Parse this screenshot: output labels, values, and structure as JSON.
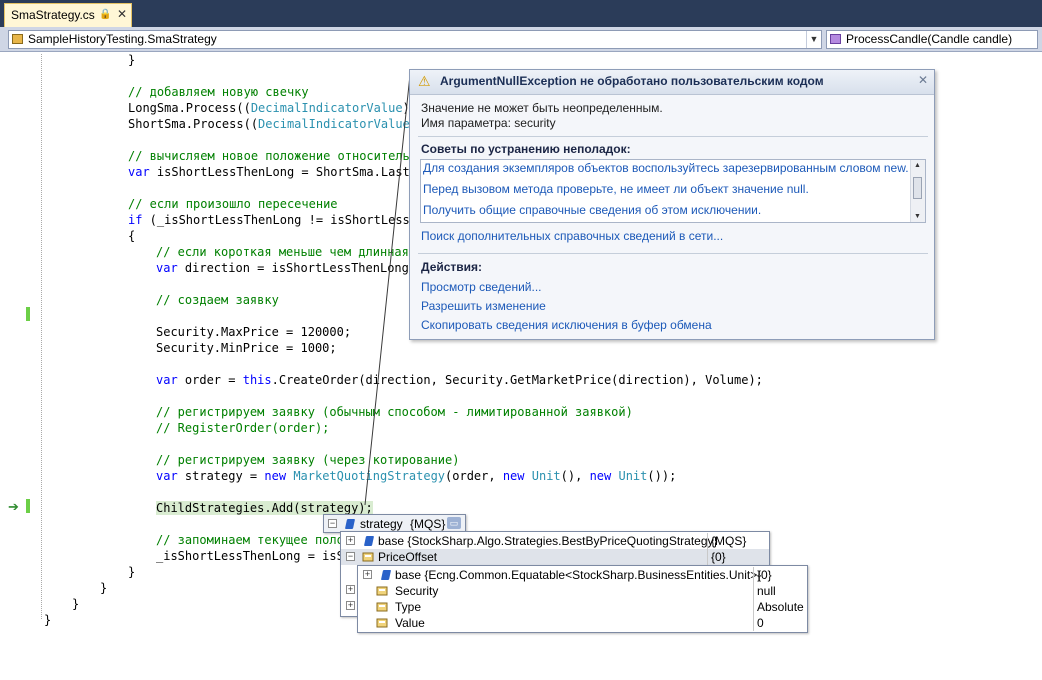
{
  "tab": {
    "title": "SmaStrategy.cs",
    "lock_icon": "lock-icon",
    "close_icon": "close-icon"
  },
  "navbar": {
    "type_combo": "SampleHistoryTesting.SmaStrategy",
    "member_combo": "ProcessCandle(Candle candle)"
  },
  "code": {
    "l1": "}",
    "l3": "// добавляем новую свечку",
    "l4a": "LongSma.Process((",
    "l4b": "DecimalIndicatorValue",
    "l4c": ")c",
    "l5a": "ShortSma.Process((",
    "l5b": "DecimalIndicatorValue",
    "l5c": ")",
    "l7": "// вычисляем новое положение относительн",
    "l8a": "var",
    "l8b": " isShortLessThenLong = ShortSma.LastV",
    "l10": "// если произошло пересечение",
    "l11a": "if",
    "l11b": " (_isShortLessThenLong != isShortLessT",
    "l12": "{",
    "l13": "// если короткая меньше чем длинная,",
    "l14a": "var",
    "l14b": " direction = isShortLessThenLong",
    "l16": "// создаем заявку",
    "l18": "Security.MaxPrice = 120000;",
    "l19": "Security.MinPrice = 1000;",
    "l21a": "var",
    "l21b": " order = ",
    "l21c": "this",
    "l21d": ".CreateOrder(direction, Security.GetMarketPrice(direction), Volume);",
    "l23": "// регистрируем заявку (обычным способом - лимитированной заявкой)",
    "l24": "// RegisterOrder(order);",
    "l26": "// регистрируем заявку (через котирование)",
    "l27a": "var",
    "l27b": " strategy = ",
    "l27c": "new",
    "l27d": " ",
    "l27e": "MarketQuotingStrategy",
    "l27f": "(order, ",
    "l27g": "new",
    "l27h": " ",
    "l27i": "Unit",
    "l27j": "(), ",
    "l27k": "new",
    "l27l": " ",
    "l27m": "Unit",
    "l27n": "());",
    "l29": "ChildStrategies.Add(strategy);",
    "l31": "// запоминаем текущее полож",
    "l32": "_isShortLessThenLong = isSh",
    "l33": "}",
    "l34": "}",
    "l35": "}",
    "l36": "}"
  },
  "exception": {
    "title": "ArgumentNullException не обработано пользовательским кодом",
    "message_1": "Значение не может быть неопределенным.",
    "message_2": "Имя параметра: security",
    "tips_header": "Советы по устранению неполадок:",
    "tips": [
      "Для создания экземпляров объектов воспользуйтесь зарезервированным словом new.",
      "Перед вызовом метода проверьте, не имеет ли объект значение null.",
      "Получить общие справочные сведения об этом исключении."
    ],
    "more_help": "Поиск дополнительных справочных сведений в сети...",
    "actions_header": "Действия:",
    "actions": [
      "Просмотр сведений...",
      "Разрешить изменение",
      "Скопировать сведения исключения в буфер обмена"
    ]
  },
  "datatip": {
    "root_name": "strategy",
    "root_value": "{MQS}",
    "level1": [
      {
        "name": "base {StockSharp.Algo.Strategies.BestByPriceQuotingStrategy}",
        "value": "{MQS}"
      },
      {
        "name": "PriceOffset",
        "value": "{0}"
      }
    ],
    "level2": [
      {
        "name": "base {Ecng.Common.Equatable<StockSharp.BusinessEntities.Unit>}",
        "value": "{0}"
      },
      {
        "name": "Security",
        "value": "null"
      },
      {
        "name": "Type",
        "value": "Absolute"
      },
      {
        "name": "Value",
        "value": "0"
      }
    ]
  }
}
